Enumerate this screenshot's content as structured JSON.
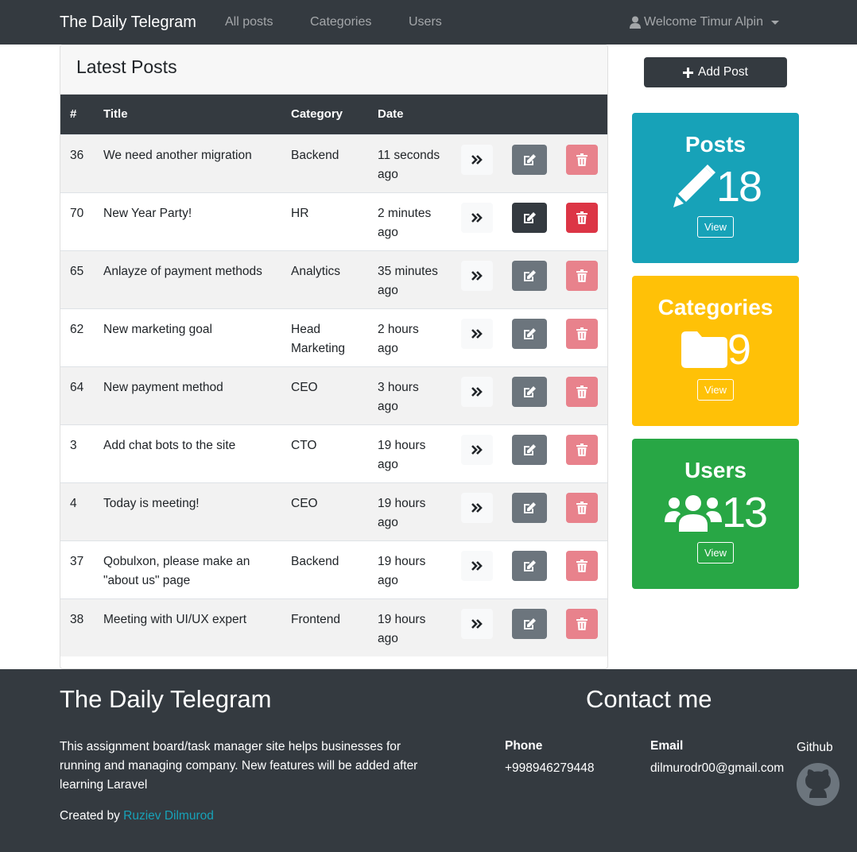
{
  "navbar": {
    "brand": "The Daily Telegram",
    "links": [
      "All posts",
      "Categories",
      "Users"
    ],
    "user": "Welcome Timur Alpin"
  },
  "posts_card": {
    "title": "Latest Posts",
    "columns": [
      "#",
      "Title",
      "Category",
      "Date"
    ],
    "rows": [
      {
        "id": "36",
        "title": "We need another migration",
        "category": "Backend",
        "date": "11 seconds ago"
      },
      {
        "id": "70",
        "title": "New Year Party!",
        "category": "HR",
        "date": "2 minutes ago"
      },
      {
        "id": "65",
        "title": "Anlayze of payment methods",
        "category": "Analytics",
        "date": "35 minutes ago"
      },
      {
        "id": "62",
        "title": "New marketing goal",
        "category": "Head Marketing",
        "date": "2 hours ago"
      },
      {
        "id": "64",
        "title": "New payment method",
        "category": "CEO",
        "date": "3 hours ago"
      },
      {
        "id": "3",
        "title": "Add chat bots to the site",
        "category": "CTO",
        "date": "19 hours ago"
      },
      {
        "id": "4",
        "title": "Today is meeting!",
        "category": "CEO",
        "date": "19 hours ago"
      },
      {
        "id": "37",
        "title": "Qobulxon, please make an \"about us\" page",
        "category": "Backend",
        "date": "19 hours ago"
      },
      {
        "id": "38",
        "title": "Meeting with UI/UX expert",
        "category": "Frontend",
        "date": "19 hours ago"
      }
    ],
    "hovered_row": 1
  },
  "sidebar": {
    "add_post_label": "Add Post",
    "stats": [
      {
        "title": "Posts",
        "count": "18",
        "view_label": "View",
        "color": "#17a2b8",
        "icon": "pencil-icon"
      },
      {
        "title": "Categories",
        "count": "9",
        "view_label": "View",
        "color": "#ffc107",
        "icon": "folder-icon"
      },
      {
        "title": "Users",
        "count": "13",
        "view_label": "View",
        "color": "#28a745",
        "icon": "users-icon"
      }
    ]
  },
  "footer": {
    "brand": "The Daily Telegram",
    "description": "This assignment board/task manager site helps businesses for running and managing company. New features will be added after learning Laravel",
    "created_prefix": "Created by",
    "author": "Ruziev Dilmurod",
    "contact_title": "Contact me",
    "phone_label": "Phone",
    "phone": "+998946279448",
    "email_label": "Email",
    "email": "dilmurodr00@gmail.com",
    "github_label": "Github"
  }
}
